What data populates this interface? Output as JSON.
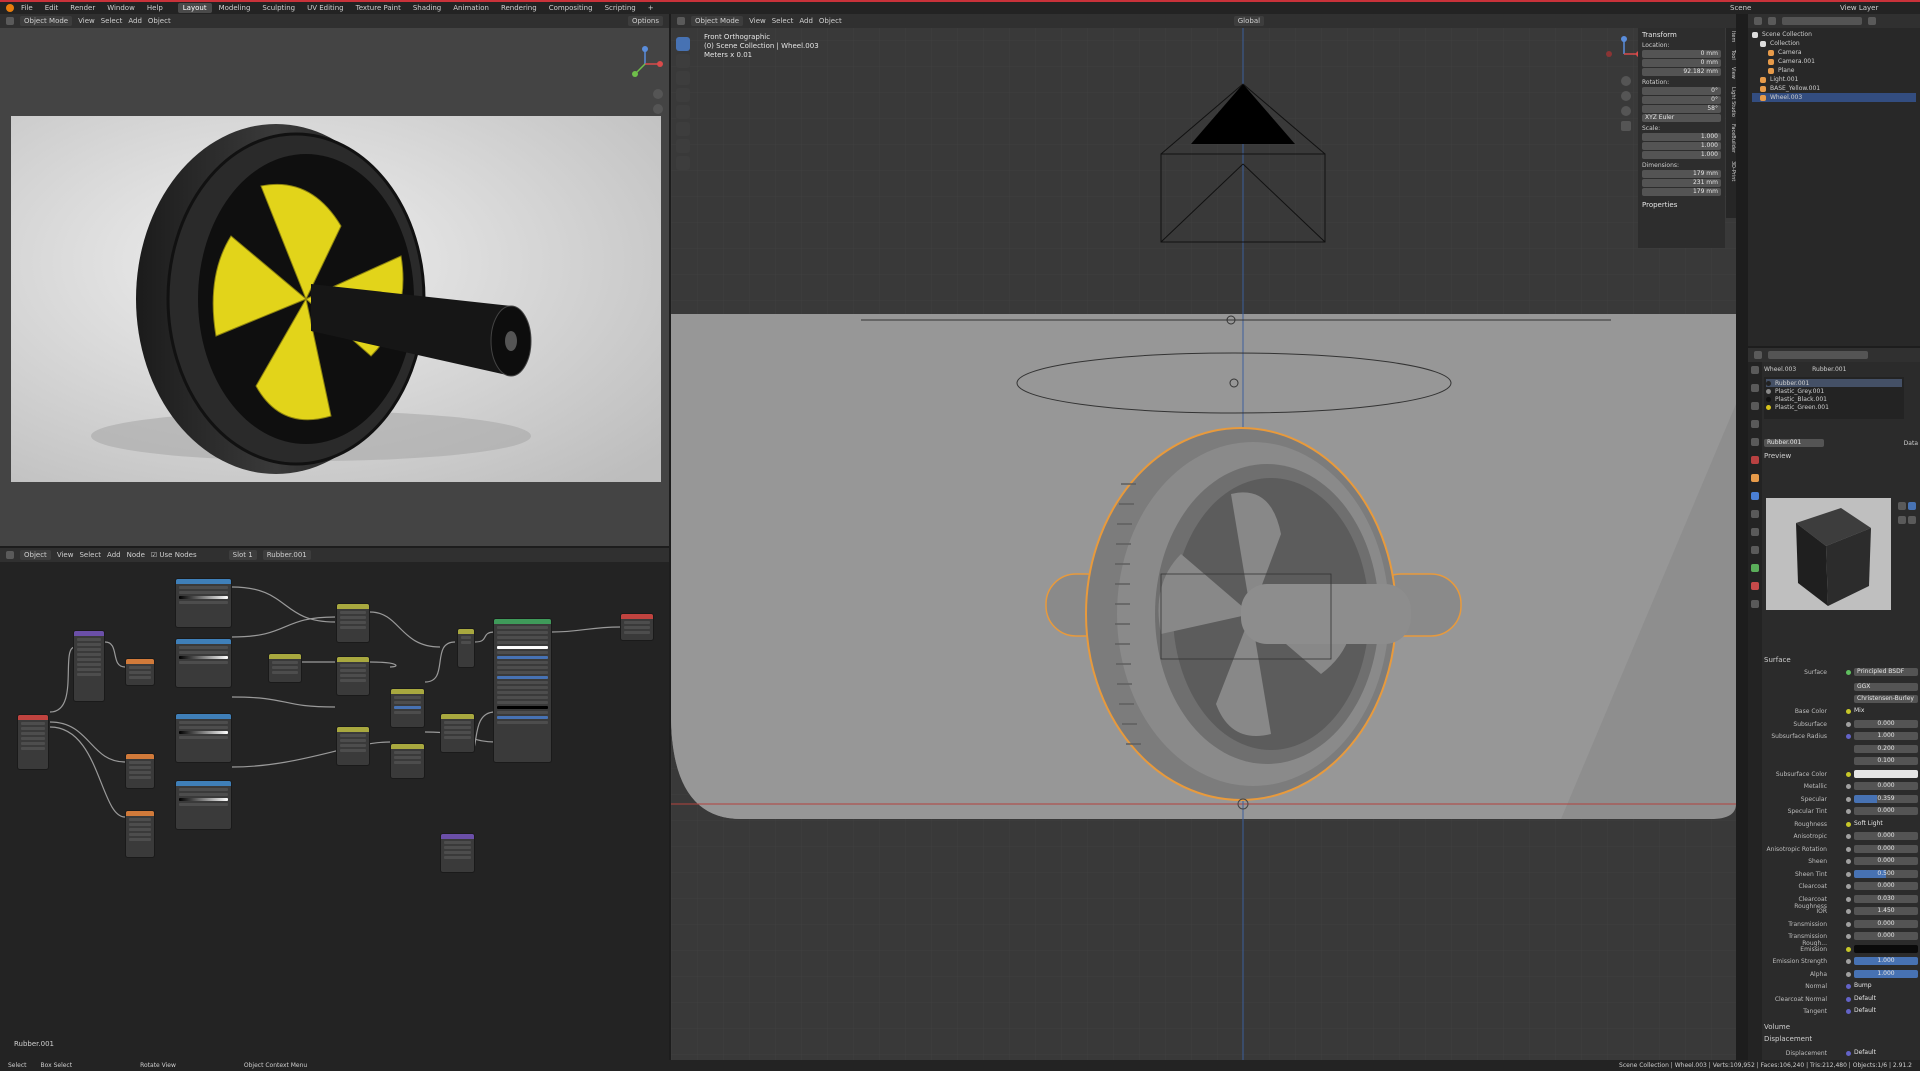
{
  "topbar": {
    "menus": [
      "File",
      "Edit",
      "Render",
      "Window",
      "Help"
    ],
    "workspaces": [
      "Layout",
      "Modeling",
      "Sculpting",
      "UV Editing",
      "Texture Paint",
      "Shading",
      "Animation",
      "Rendering",
      "Compositing",
      "Scripting"
    ],
    "active_workspace": "Layout",
    "scene": "Scene",
    "view_layer": "View Layer"
  },
  "render_view": {
    "mode": "Object Mode",
    "menus": [
      "View",
      "Select",
      "Add",
      "Object"
    ],
    "transform": "Global",
    "options": "Options"
  },
  "main_view": {
    "mode": "Object Mode",
    "menus": [
      "View",
      "Select",
      "Add",
      "Object"
    ],
    "transform": "Global",
    "overlay_title": "Front Orthographic",
    "overlay_collection": "(0) Scene Collection | Wheel.003",
    "overlay_scale": "Meters x 0.01"
  },
  "n_panel": {
    "transform_title": "Transform",
    "location_label": "Location:",
    "location": {
      "x": "0 mm",
      "y": "0 mm",
      "z": "92.182 mm"
    },
    "rotation_label": "Rotation:",
    "rotation": {
      "x": "0°",
      "y": "0°",
      "z": "58°"
    },
    "rotation_mode": "XYZ Euler",
    "scale_label": "Scale:",
    "scale": {
      "x": "1.000",
      "y": "1.000",
      "z": "1.000"
    },
    "dimensions_label": "Dimensions:",
    "dimensions": {
      "x": "179 mm",
      "y": "231 mm",
      "z": "179 mm"
    },
    "properties_title": "Properties",
    "tabs": [
      "Item",
      "Tool",
      "View",
      "Light Studio",
      "FaceBuilder",
      "3D-Print"
    ]
  },
  "node_editor": {
    "mode": "Object",
    "menus": [
      "View",
      "Select",
      "Add",
      "Node"
    ],
    "use_nodes": "Use Nodes",
    "slot": "Slot 1",
    "material": "Rubber.001",
    "footer_label": "Rubber.001"
  },
  "outliner": {
    "root": "Scene Collection",
    "items": [
      {
        "name": "Collection",
        "depth": 1
      },
      {
        "name": "Camera",
        "depth": 2
      },
      {
        "name": "Camera.001",
        "depth": 2
      },
      {
        "name": "Plane",
        "depth": 2
      },
      {
        "name": "Light.001",
        "depth": 1
      },
      {
        "name": "BASE_Yellow.001",
        "depth": 1
      },
      {
        "name": "Wheel.003",
        "depth": 1,
        "selected": true
      }
    ]
  },
  "properties": {
    "object": "Wheel.003",
    "material_link": "Rubber.001",
    "materials": [
      "Rubber.001",
      "Plastic_Grey.001",
      "Plastic_Black.001",
      "Plastic_Green.001"
    ],
    "material_name": "Rubber.001",
    "data_label": "Data",
    "preview_label": "Preview",
    "surface_section": "Surface",
    "surface_label": "Surface",
    "surface_value": "Principled BSDF",
    "distribution": "GGX",
    "subsurface_method": "Christensen-Burley",
    "rows": [
      {
        "label": "Base Color",
        "value": "Mix"
      },
      {
        "label": "Subsurface",
        "value": "0.000"
      },
      {
        "label": "Subsurface Radius",
        "value": "1.000"
      },
      {
        "label": "",
        "value": "0.200"
      },
      {
        "label": "",
        "value": "0.100"
      },
      {
        "label": "Subsurface Color",
        "value": ""
      },
      {
        "label": "Metallic",
        "value": "0.000"
      },
      {
        "label": "Specular",
        "value": "0.359"
      },
      {
        "label": "Specular Tint",
        "value": "0.000"
      },
      {
        "label": "Roughness",
        "value": "Soft Light"
      },
      {
        "label": "Anisotropic",
        "value": "0.000"
      },
      {
        "label": "Anisotropic Rotation",
        "value": "0.000"
      },
      {
        "label": "Sheen",
        "value": "0.000"
      },
      {
        "label": "Sheen Tint",
        "value": "0.500"
      },
      {
        "label": "Clearcoat",
        "value": "0.000"
      },
      {
        "label": "Clearcoat Roughness",
        "value": "0.030"
      },
      {
        "label": "IOR",
        "value": "1.450"
      },
      {
        "label": "Transmission",
        "value": "0.000"
      },
      {
        "label": "Transmission Rough...",
        "value": "0.000"
      },
      {
        "label": "Emission",
        "value": ""
      },
      {
        "label": "Emission Strength",
        "value": "1.000"
      },
      {
        "label": "Alpha",
        "value": "1.000"
      },
      {
        "label": "Normal",
        "value": "Bump"
      },
      {
        "label": "Clearcoat Normal",
        "value": "Default"
      },
      {
        "label": "Tangent",
        "value": "Default"
      }
    ],
    "volume_section": "Volume",
    "displacement_section": "Displacement",
    "displacement_label": "Displacement",
    "displacement_value": "Default"
  },
  "statusbar": {
    "select": "Select",
    "box_select": "Box Select",
    "rotate_view": "Rotate View",
    "context_menu": "Object Context Menu",
    "stats": "Scene Collection | Wheel.003 | Verts:109,952 | Faces:106,240 | Tris:212,480 | Objects:1/6 | 2.91.2"
  },
  "colors": {
    "accent": "#4772b3",
    "selection_outline": "#e89a3c",
    "rubber_dark": "#2a2a2a",
    "wheel_yellow": "#e2d41a"
  }
}
